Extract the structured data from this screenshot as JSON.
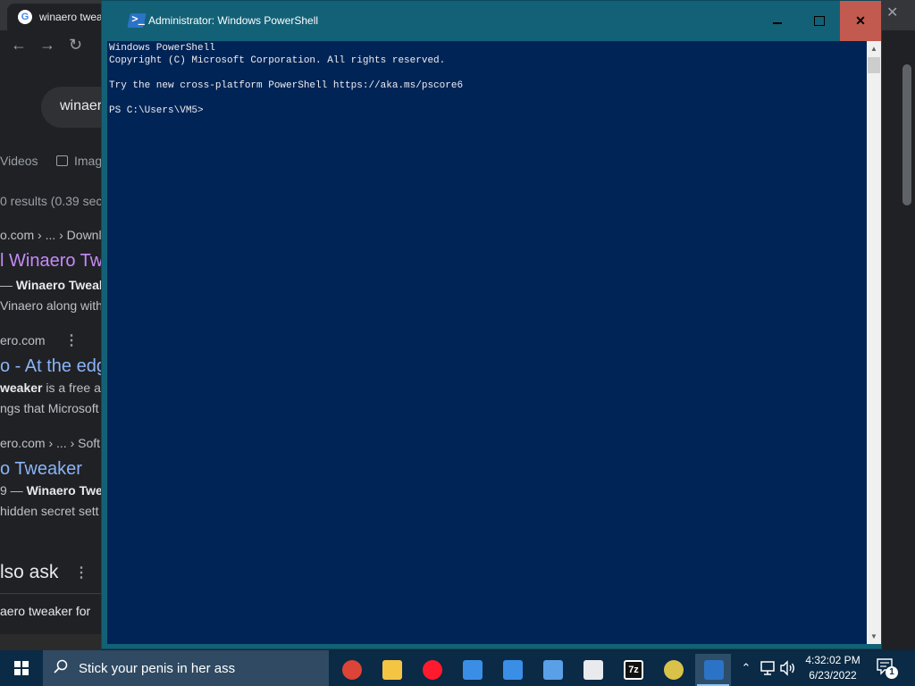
{
  "browser": {
    "tab_title": "winaero twea",
    "search_query": "winaer",
    "filters": {
      "videos": "Videos",
      "images": "Imag"
    },
    "results_count": "0 results (0.39 sec",
    "results": [
      {
        "cite": "o.com › ... › Downl",
        "title": "l Winaero Tw",
        "snippet_a": "— ",
        "snippet_b": "Winaero Tweake",
        "snippet2": "Vinaero along with"
      },
      {
        "cite": "ero.com",
        "title": "o - At the edg",
        "snippet_b": "weaker",
        "snippet_c": " is a free ap",
        "snippet2": "ngs that Microsoft "
      },
      {
        "cite": "ero.com › ... › Soft",
        "title": "o Tweaker",
        "snippet_a": "9 — ",
        "snippet_b": "Winaero Twea",
        "snippet2": " hidden secret sett"
      }
    ],
    "people_also_ask": "lso ask",
    "question": "aero tweaker for"
  },
  "powershell": {
    "title": "Administrator: Windows PowerShell",
    "lines": [
      "Windows PowerShell",
      "Copyright (C) Microsoft Corporation. All rights reserved.",
      "",
      "Try the new cross-platform PowerShell https://aka.ms/pscore6",
      "",
      "PS C:\\Users\\VM5>"
    ],
    "close_glyph": "✕"
  },
  "taskbar": {
    "search_text": "Stick your penis in her ass",
    "pinned": [
      {
        "name": "chrome",
        "color": "#db4437"
      },
      {
        "name": "file-explorer",
        "color": "#f4c542"
      },
      {
        "name": "opera",
        "color": "#ff1b2d"
      },
      {
        "name": "app-monitor",
        "color": "#3a8ee6"
      },
      {
        "name": "app-network",
        "color": "#3a8ee6"
      },
      {
        "name": "app-remote",
        "color": "#5aa0e6"
      },
      {
        "name": "app-box",
        "color": "#e8eaed"
      },
      {
        "name": "7zip",
        "color": "#ffffff",
        "label": "7z"
      },
      {
        "name": "app-disc",
        "color": "#d9c24a"
      },
      {
        "name": "powershell",
        "color": "#2b73c7"
      }
    ],
    "time": "4:32:02 PM",
    "date": "6/23/2022",
    "notification_count": "1"
  }
}
